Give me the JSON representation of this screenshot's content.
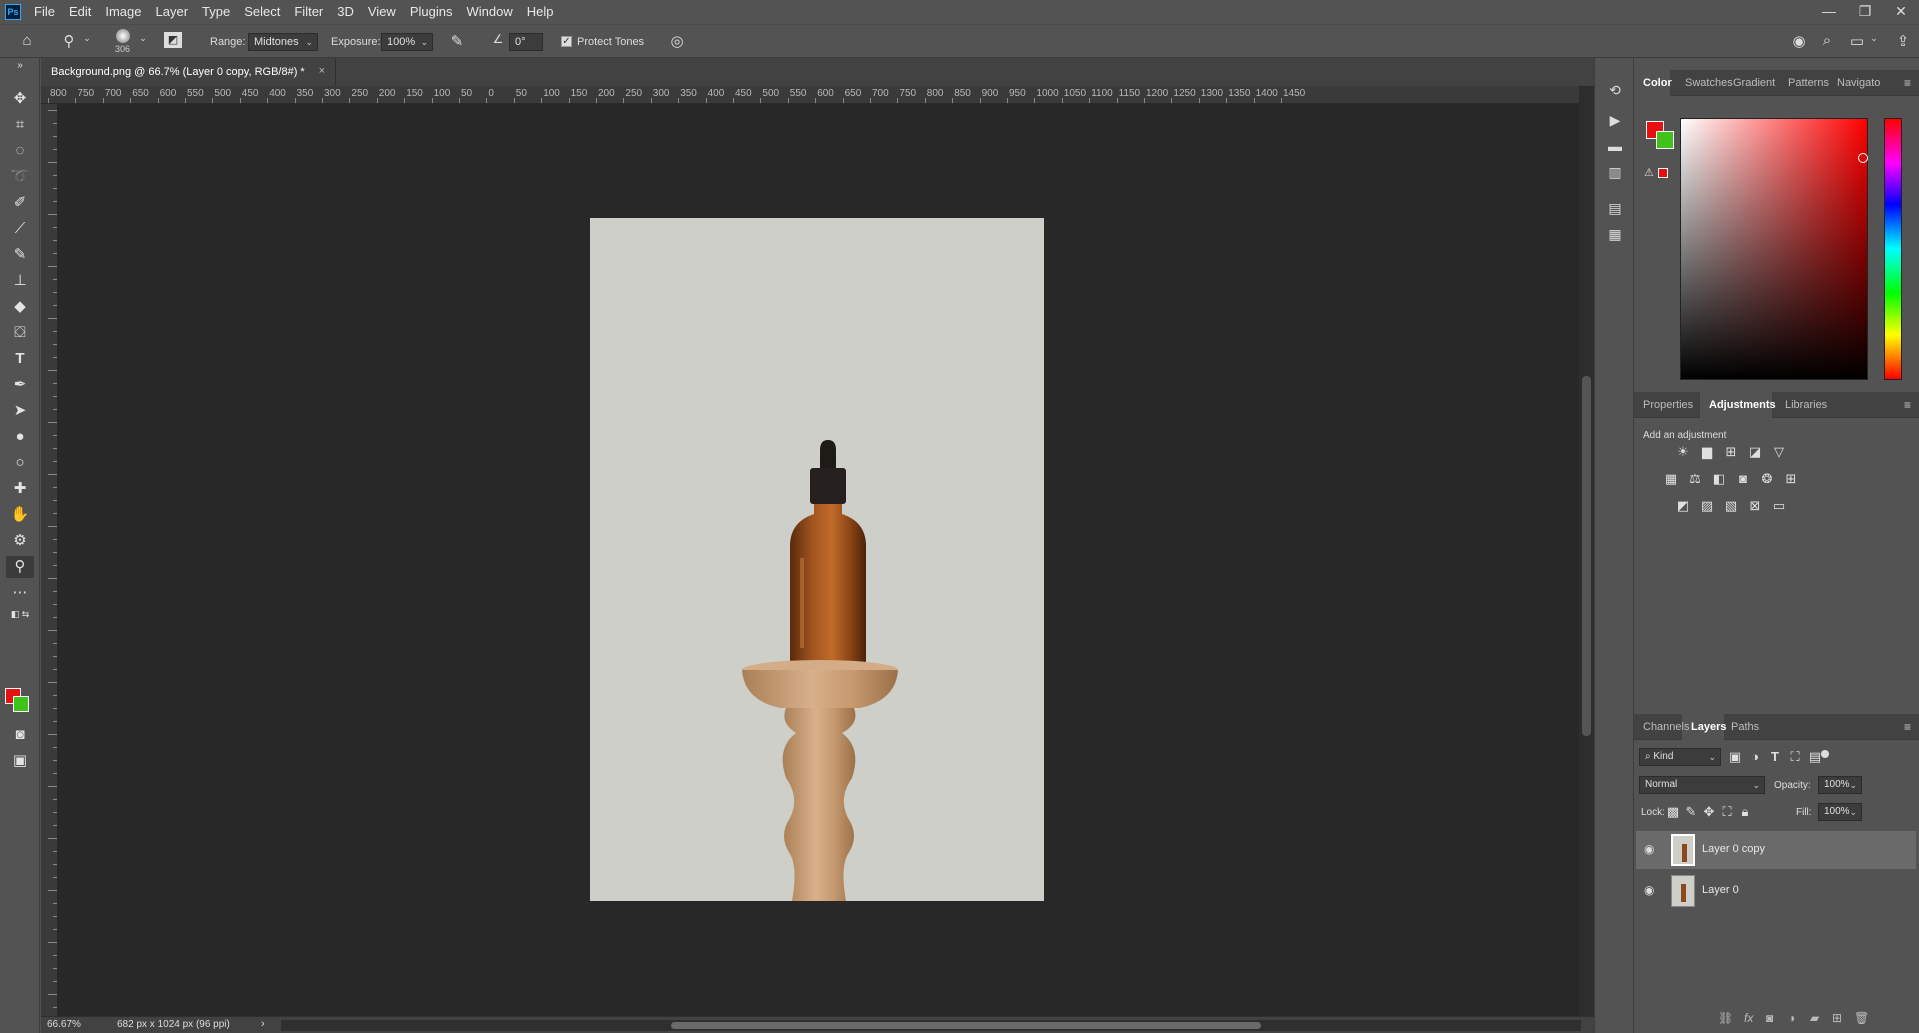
{
  "app": {
    "logo": "Ps",
    "menu": [
      "File",
      "Edit",
      "Image",
      "Layer",
      "Type",
      "Select",
      "Filter",
      "3D",
      "View",
      "Plugins",
      "Window",
      "Help"
    ],
    "window_controls": [
      "—",
      "❐",
      "✕"
    ]
  },
  "options_bar": {
    "brush_size": "306",
    "range_label": "Range:",
    "range_value": "Midtones",
    "exposure_label": "Exposure:",
    "exposure_value": "100%",
    "angle_value": "0°",
    "protect_tones_label": "Protect Tones",
    "protect_tones_checked": true
  },
  "document": {
    "tab_title": "Background.png @ 66.7% (Layer 0 copy, RGB/8#) *",
    "close_glyph": "×",
    "ruler_labels": [
      "800",
      "750",
      "700",
      "650",
      "600",
      "550",
      "500",
      "450",
      "400",
      "350",
      "300",
      "250",
      "200",
      "150",
      "100",
      "50",
      "0",
      "50",
      "100",
      "150",
      "200",
      "250",
      "300",
      "350",
      "400",
      "450",
      "500",
      "550",
      "600",
      "650",
      "700",
      "750",
      "800",
      "850",
      "900",
      "950",
      "1000",
      "1050",
      "1100",
      "1150",
      "1200",
      "1250",
      "1300",
      "1350",
      "1400",
      "1450"
    ]
  },
  "status": {
    "zoom": "66.67%",
    "dimensions": "682 px x 1024 px (96 ppi)",
    "arrow": "›"
  },
  "color_panel": {
    "tabs": [
      "Color",
      "Swatches",
      "Gradient",
      "Patterns",
      "Navigato"
    ],
    "active_tab": "Color",
    "foreground": "#e80f0f",
    "background": "#3fc31a"
  },
  "adjustments_panel": {
    "tabs": [
      "Properties",
      "Adjustments",
      "Libraries"
    ],
    "active_tab": "Adjustments",
    "add_label": "Add an adjustment"
  },
  "layers_panel": {
    "tabs": [
      "Channels",
      "Layers",
      "Paths"
    ],
    "active_tab": "Layers",
    "kind_label": "Kind",
    "blend_mode": "Normal",
    "opacity_label": "Opacity:",
    "opacity_value": "100%",
    "lock_label": "Lock:",
    "fill_label": "Fill:",
    "fill_value": "100%",
    "layers": [
      {
        "name": "Layer 0 copy",
        "visible": true,
        "selected": true
      },
      {
        "name": "Layer 0",
        "visible": true,
        "selected": false
      }
    ]
  }
}
